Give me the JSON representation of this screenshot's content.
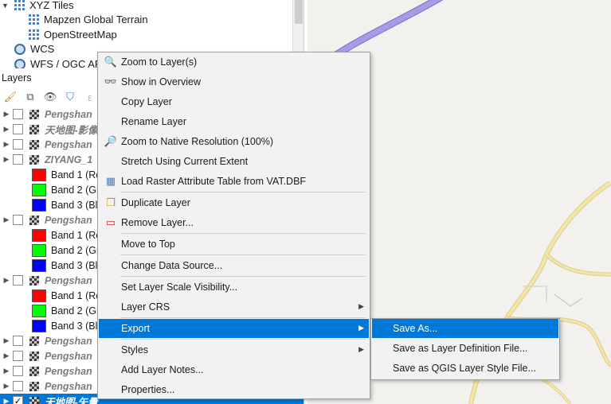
{
  "browser": {
    "items": [
      {
        "label": "XYZ Tiles",
        "icon": "grid-icon"
      },
      {
        "label": "Mapzen Global Terrain",
        "icon": "grid-icon"
      },
      {
        "label": "OpenStreetMap",
        "icon": "grid-icon"
      },
      {
        "label": "WCS",
        "icon": "globe-icon"
      },
      {
        "label": "WFS / OGC API",
        "icon": "globe-icon"
      }
    ]
  },
  "layers": {
    "title": "Layers",
    "rows": [
      {
        "type": "layer",
        "name": "Pengshan",
        "checked": false
      },
      {
        "type": "layer",
        "name": "天地图-影像",
        "checked": false
      },
      {
        "type": "layer",
        "name": "Pengshan",
        "checked": false
      },
      {
        "type": "layer",
        "name": "ZIYANG_1",
        "checked": false
      },
      {
        "type": "band",
        "label": "Band 1 (Re",
        "color": "#ff0000"
      },
      {
        "type": "band",
        "label": "Band 2 (Gr",
        "color": "#00ff00"
      },
      {
        "type": "band",
        "label": "Band 3 (Bl",
        "color": "#0000ff"
      },
      {
        "type": "layer",
        "name": "Pengshan",
        "checked": false
      },
      {
        "type": "band",
        "label": "Band 1 (Re",
        "color": "#ff0000"
      },
      {
        "type": "band",
        "label": "Band 2 (Gr",
        "color": "#00ff00"
      },
      {
        "type": "band",
        "label": "Band 3 (Bl",
        "color": "#0000ff"
      },
      {
        "type": "layer",
        "name": "Pengshan",
        "checked": false
      },
      {
        "type": "band",
        "label": "Band 1 (Re",
        "color": "#ff0000"
      },
      {
        "type": "band",
        "label": "Band 2 (Gr",
        "color": "#00ff00"
      },
      {
        "type": "band",
        "label": "Band 3 (Bl",
        "color": "#0000ff"
      },
      {
        "type": "layer",
        "name": "Pengshan",
        "checked": false
      },
      {
        "type": "layer",
        "name": "Pengshan",
        "checked": false
      },
      {
        "type": "layer",
        "name": "Pengshan",
        "checked": false
      },
      {
        "type": "layer",
        "name": "Pengshan",
        "checked": false
      },
      {
        "type": "layer",
        "name": "天地图-矢量",
        "checked": true,
        "selected": true
      }
    ]
  },
  "context_menu": {
    "items": [
      {
        "label": "Zoom to Layer(s)",
        "icon": "zoom-layer-icon"
      },
      {
        "label": "Show in Overview",
        "icon": "overview-icon"
      },
      {
        "label": "Copy Layer",
        "icon": ""
      },
      {
        "label": "Rename Layer",
        "icon": ""
      },
      {
        "label": "Zoom to Native Resolution (100%)",
        "icon": "zoom-native-icon"
      },
      {
        "label": "Stretch Using Current Extent",
        "icon": ""
      },
      {
        "label": "Load Raster Attribute Table from VAT.DBF",
        "icon": "table-icon"
      },
      {
        "label": "Duplicate Layer",
        "icon": "duplicate-icon"
      },
      {
        "label": "Remove Layer...",
        "icon": "remove-icon"
      },
      {
        "label": "Move to Top",
        "icon": ""
      },
      {
        "label": "Change Data Source...",
        "icon": ""
      },
      {
        "label": "Set Layer Scale Visibility...",
        "icon": ""
      },
      {
        "label": "Layer CRS",
        "icon": "",
        "submenu": true
      },
      {
        "label": "Export",
        "icon": "",
        "submenu": true,
        "active": true
      },
      {
        "label": "Styles",
        "icon": "",
        "submenu": true
      },
      {
        "label": "Add Layer Notes...",
        "icon": ""
      },
      {
        "label": "Properties...",
        "icon": ""
      }
    ]
  },
  "export_submenu": {
    "items": [
      {
        "label": "Save As...",
        "active": true
      },
      {
        "label": "Save as Layer Definition File..."
      },
      {
        "label": "Save as QGIS Layer Style File..."
      }
    ]
  },
  "colors": {
    "accent": "#0078d7",
    "road_purple": "#a89ae6",
    "road_yellow": "#f5e6a8"
  }
}
